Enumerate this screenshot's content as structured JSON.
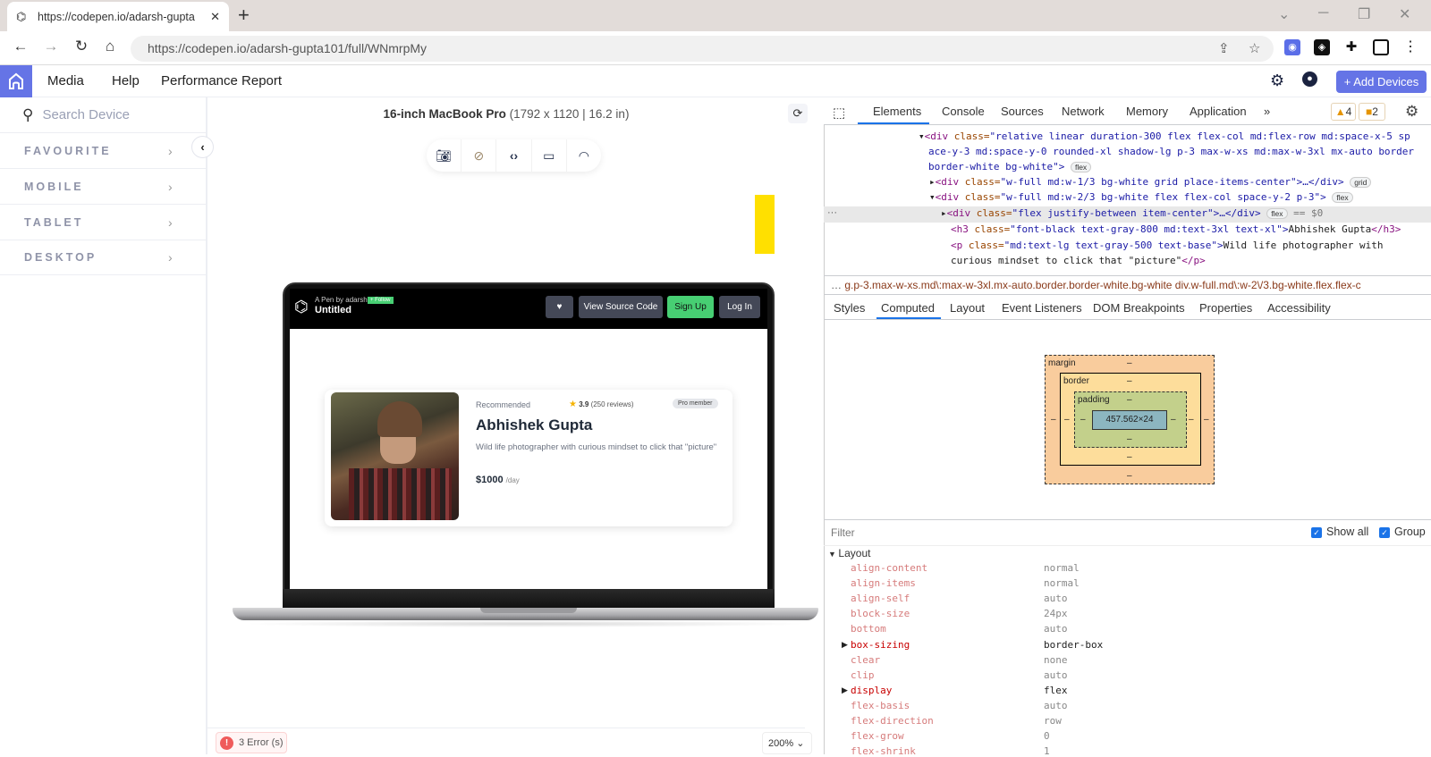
{
  "browser": {
    "tab_title": "https://codepen.io/adarsh-gupta",
    "url": "https://codepen.io/adarsh-gupta101/full/WNmrpMy",
    "new_tab": "+",
    "tab_close": "✕"
  },
  "app": {
    "menu": [
      "Media",
      "Help",
      "Performance Report"
    ],
    "add_devices_label": "+ Add Devices"
  },
  "sidebar": {
    "search_placeholder": "Search Device",
    "items": [
      {
        "label": "FAVOURITE"
      },
      {
        "label": "MOBILE"
      },
      {
        "label": "TABLET"
      },
      {
        "label": "DESKTOP"
      }
    ]
  },
  "device": {
    "name": "16-inch MacBook Pro",
    "specs": "(1792 x 1120 | 16.2 in)",
    "toolbar_icons": [
      "camera-icon",
      "rotate-icon",
      "code-icon",
      "video-icon",
      "wifi-icon"
    ]
  },
  "codepen": {
    "byline": "A Pen by adarsh",
    "follow": "+ Follow",
    "title": "Untitled",
    "heart": "♥",
    "view_source": "View Source Code",
    "sign_up": "Sign Up",
    "log_in": "Log In",
    "brand_green": "#47cf73"
  },
  "profile_card": {
    "label": "Recommended",
    "rating": "3.9",
    "reviews": "(250 reviews)",
    "badge": "Pro member",
    "name": "Abhishek Gupta",
    "description": "Wild life photographer with curious mindset to click that \"picture\"",
    "price": "$1000",
    "price_unit": "/day"
  },
  "footer": {
    "errors": "3 Error (s)",
    "zoom": "200%"
  },
  "devtools": {
    "tabs": [
      "Elements",
      "Console",
      "Sources",
      "Network",
      "Memory",
      "Application",
      "»"
    ],
    "active_tab": "Elements",
    "warnings": "4",
    "issues": "2",
    "dom_lines": [
      {
        "tag": "<div ",
        "attr": "class=",
        "val": "\"relative linear duration-300 flex flex-col md:flex-row md:space-x-5 sp"
      },
      {
        "tag": "",
        "attr": "",
        "val": "ace-y-3 md:space-y-0 rounded-xl shadow-lg p-3 max-w-xs md:max-w-3xl mx-auto border"
      },
      {
        "tag": "",
        "attr": "",
        "val": "border-white bg-white\">",
        "pill": "flex"
      },
      {
        "tag": "<div ",
        "attr": "class=",
        "val": "\"w-full md:w-1/3 bg-white grid place-items-center\">…</div>",
        "pill": "grid"
      },
      {
        "tag": "<div ",
        "attr": "class=",
        "val": "\"w-full md:w-2/3 bg-white flex flex-col space-y-2 p-3\">",
        "pill": "flex"
      },
      {
        "tag": "<div ",
        "attr": "class=",
        "val": "\"flex justify-between item-center\">…</div>",
        "pill": "flex",
        "suffix": " == $0"
      },
      {
        "tag": "<h3 ",
        "attr": "class=",
        "val": "\"font-black text-gray-800 md:text-3xl text-xl\">",
        "text": "Abhishek Gupta",
        "close": "</h3>"
      },
      {
        "tag": "<p ",
        "attr": "class=",
        "val": "\"md:text-lg text-gray-500 text-base\">",
        "text": "Wild life photographer with"
      },
      {
        "tag": "",
        "attr": "",
        "val": "",
        "text": "curious mindset to click that \"picture\"",
        "close": "</p>"
      }
    ],
    "breadcrumb": "g.p-3.max-w-xs.md\\:max-w-3xl.mx-auto.border.border-white.bg-white     div.w-full.md\\:w-2\\/3.bg-white.flex.flex-c",
    "subtabs": [
      "Styles",
      "Computed",
      "Layout",
      "Event Listeners",
      "DOM Breakpoints",
      "Properties",
      "Accessibility"
    ],
    "active_subtab": "Computed",
    "box_model": {
      "margin_label": "margin",
      "border_label": "border",
      "padding_label": "padding",
      "content": "457.562×24",
      "dash": "–"
    },
    "filter_placeholder": "Filter",
    "show_all": "Show all",
    "group": "Group",
    "section": "Layout",
    "properties": [
      {
        "name": "align-content",
        "value": "normal"
      },
      {
        "name": "align-items",
        "value": "normal"
      },
      {
        "name": "align-self",
        "value": "auto"
      },
      {
        "name": "block-size",
        "value": "24px"
      },
      {
        "name": "bottom",
        "value": "auto"
      },
      {
        "name": "box-sizing",
        "value": "border-box",
        "expandable": true
      },
      {
        "name": "clear",
        "value": "none"
      },
      {
        "name": "clip",
        "value": "auto"
      },
      {
        "name": "display",
        "value": "flex",
        "expandable": true
      },
      {
        "name": "flex-basis",
        "value": "auto"
      },
      {
        "name": "flex-direction",
        "value": "row"
      },
      {
        "name": "flex-grow",
        "value": "0"
      },
      {
        "name": "flex-shrink",
        "value": "1"
      }
    ]
  }
}
